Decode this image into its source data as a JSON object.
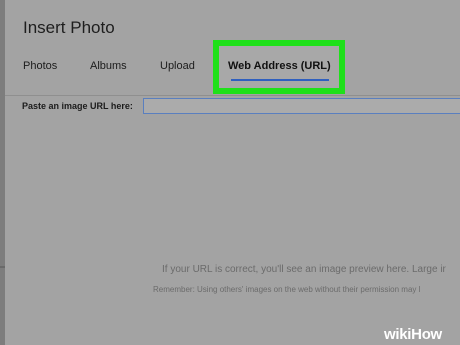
{
  "dialog": {
    "title": "Insert Photo"
  },
  "tabs": [
    {
      "label": "Photos"
    },
    {
      "label": "Albums"
    },
    {
      "label": "Upload"
    },
    {
      "label": "Web Address (URL)",
      "active": true
    }
  ],
  "url_field": {
    "label": "Paste an image URL here:",
    "value": "",
    "placeholder": ""
  },
  "preview": {
    "hint": "If your URL is correct, you'll see an image preview here. Large ir",
    "warning": "Remember: Using others' images on the web without their permission may l"
  },
  "watermark": {
    "wiki": "wiki",
    "how": "How"
  },
  "colors": {
    "highlight_border": "#1fe01a",
    "active_underline": "#2f5fbf",
    "background": "#a3a3a3"
  }
}
